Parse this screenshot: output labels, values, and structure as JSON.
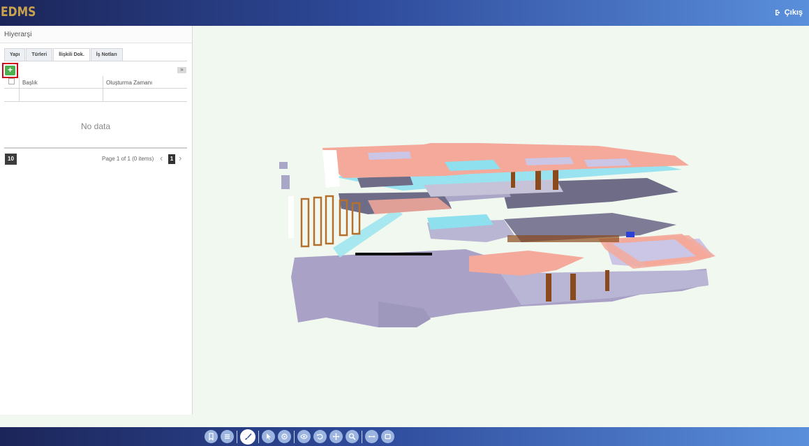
{
  "header": {
    "logo": "EDMS",
    "logout_label": "Çıkış"
  },
  "panel": {
    "title": "Hiyerarşi",
    "tabs": [
      {
        "label": "Yapı",
        "active": false
      },
      {
        "label": "Türleri",
        "active": false
      },
      {
        "label": "İlişkili Dok.",
        "active": true
      },
      {
        "label": "İş Notları",
        "active": false
      }
    ],
    "grid": {
      "columns": [
        "Başlık",
        "Oluşturma Zamanı"
      ],
      "empty_text": "No data",
      "page_size": "10",
      "page_info": "Page 1 of 1 (0 items)",
      "current_page": "1"
    }
  },
  "toolbar": {
    "icons": [
      "bookmark-icon",
      "list-icon",
      "brush-icon",
      "pointer-icon",
      "target-icon",
      "eye-icon",
      "rotate-icon",
      "pan-icon",
      "zoom-icon",
      "fit-width-icon",
      "window-icon"
    ]
  },
  "colors": {
    "header_dark": "#1c2559",
    "header_light": "#5a8fdc",
    "logo": "#c9a24e",
    "add_button": "#4caf50",
    "highlight": "#d0021b",
    "viewer_bg": "#f0f8ef"
  }
}
